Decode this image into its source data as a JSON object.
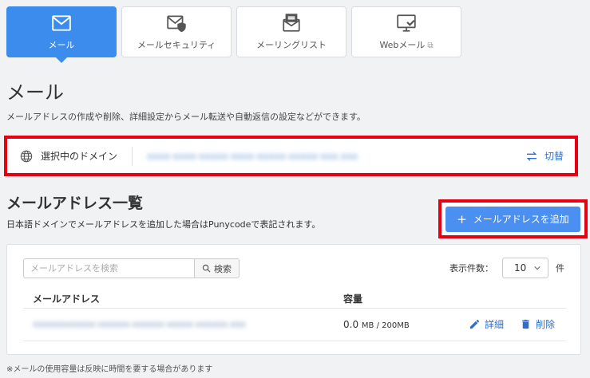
{
  "tabs": [
    {
      "label": "メール",
      "icon": "mail-icon",
      "active": true
    },
    {
      "label": "メールセキュリティ",
      "icon": "mail-shield-icon",
      "active": false
    },
    {
      "label": "メーリングリスト",
      "icon": "mailing-list-icon",
      "active": false
    },
    {
      "label": "Webメール",
      "icon": "webmail-icon",
      "active": false,
      "external": true
    }
  ],
  "page": {
    "title": "メール",
    "description": "メールアドレスの作成や削除、詳細設定からメール転送や自動返信の設定などができます。"
  },
  "domain": {
    "label": "選択中のドメイン",
    "value": "xxxx-xxxx-xxxxx-xxxx-xxxxx-xxxxx-xxx.xxx",
    "switch_label": "切替"
  },
  "list": {
    "title": "メールアドレス一覧",
    "description": "日本語ドメインでメールアドレスを追加した場合はPunycodeで表記されます。",
    "add_button": "メールアドレスを追加",
    "search_placeholder": "メールアドレスを検索",
    "search_button": "検索",
    "per_page_label": "表示件数：",
    "per_page_value": "10",
    "per_page_unit": "件",
    "columns": [
      "メールアドレス",
      "容量"
    ],
    "rows": [
      {
        "email": "xxxxxxxxxxxx-xxxxxx-xxxxxx-xxxxx-xxxxxx.xxx",
        "capacity_value": "0.0",
        "capacity_unit": "MB / 200MB",
        "detail_label": "詳細",
        "delete_label": "削除"
      }
    ]
  },
  "footnote": "※メールの使用容量は反映に時間を要する場合があります",
  "colors": {
    "accent": "#3b8ced",
    "highlight": "#e60012",
    "link": "#2f6fc8",
    "button": "#4b8ff0"
  }
}
